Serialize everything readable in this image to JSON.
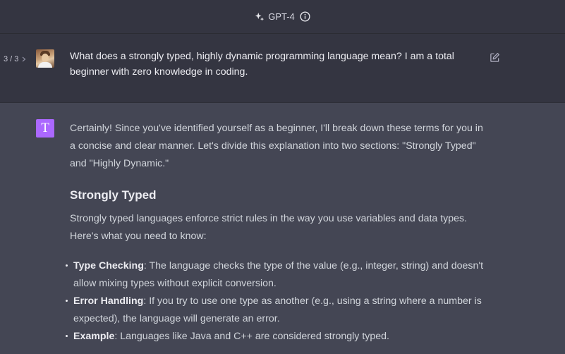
{
  "header": {
    "model_label": "GPT-4",
    "icons": [
      "sparkle-icon",
      "info-icon"
    ]
  },
  "user_message": {
    "pager": "3 / 3",
    "text": "What does a strongly typed, highly dynamic programming language mean? I am a total beginner with zero knowledge in coding.",
    "icons": [
      "chevron-right-icon",
      "edit-icon"
    ]
  },
  "assistant_message": {
    "avatar_letter": "T",
    "avatar_color": "#ab68ff",
    "intro": "Certainly! Since you've identified yourself as a beginner, I'll break down these terms for you in a concise and clear manner. Let's divide this explanation into two sections: \"Strongly Typed\" and \"Highly Dynamic.\"",
    "section_title": "Strongly Typed",
    "section_intro": "Strongly typed languages enforce strict rules in the way you use variables and data types. Here's what you need to know:",
    "bullets": [
      {
        "term": "Type Checking",
        "text": ": The language checks the type of the value (e.g., integer, string) and doesn't allow mixing types without explicit conversion."
      },
      {
        "term": "Error Handling",
        "text": ": If you try to use one type as another (e.g., using a string where a number is expected), the language will generate an error."
      },
      {
        "term": "Example",
        "text": ": Languages like Java and C++ are considered strongly typed."
      }
    ]
  },
  "colors": {
    "top_background": "#343541",
    "assistant_background": "#444654",
    "text": "#d1d5db"
  }
}
